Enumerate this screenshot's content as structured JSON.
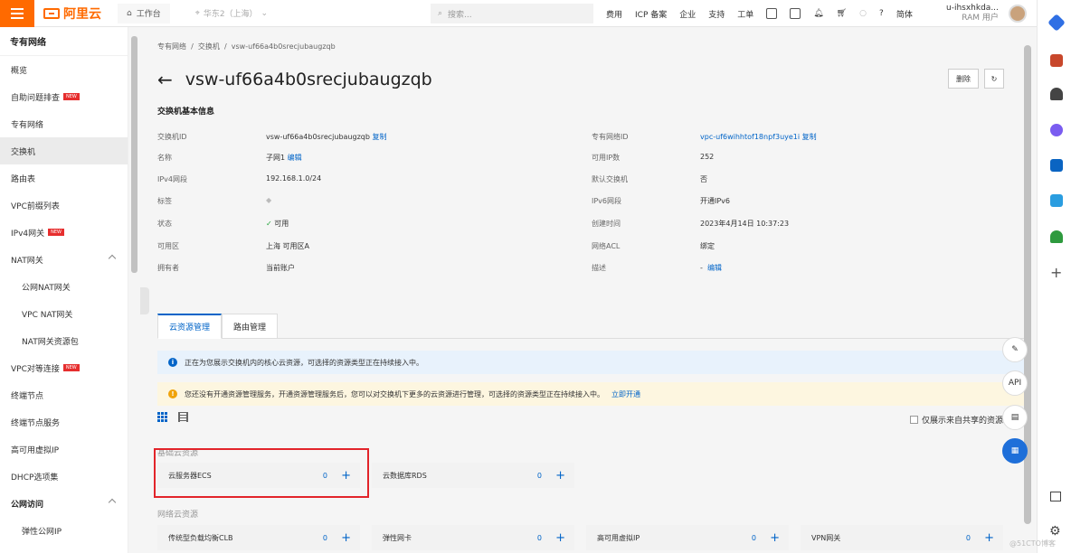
{
  "topbar": {
    "logo_text": "阿里云",
    "workbench": "工作台",
    "region": "华东2（上海）",
    "search_placeholder": "搜索...",
    "nav": [
      "费用",
      "ICP 备案",
      "企业",
      "支持",
      "工单",
      "简体"
    ],
    "username": "u-ihsxhkda...",
    "user_role": "RAM 用户"
  },
  "sidebar": {
    "title": "专有网络",
    "items": [
      {
        "label": "概览"
      },
      {
        "label": "自助问题排查",
        "badge": "NEW"
      },
      {
        "label": "专有网络"
      },
      {
        "label": "交换机",
        "active": true
      },
      {
        "label": "路由表"
      },
      {
        "label": "VPC前缀列表"
      },
      {
        "label": "IPv4网关",
        "badge": "NEW"
      },
      {
        "label": "NAT网关",
        "expanded": true
      },
      {
        "label": "公网NAT网关",
        "sub": true
      },
      {
        "label": "VPC NAT网关",
        "sub": true
      },
      {
        "label": "NAT网关资源包",
        "sub": true
      },
      {
        "label": "VPC对等连接",
        "badge": "NEW"
      },
      {
        "label": "终端节点"
      },
      {
        "label": "终端节点服务"
      },
      {
        "label": "高可用虚拟IP"
      },
      {
        "label": "DHCP选项集"
      },
      {
        "label": "公网访问",
        "group": true,
        "expanded": true
      },
      {
        "label": "弹性公网IP",
        "sub": true
      }
    ]
  },
  "main": {
    "breadcrumb": [
      "专有网络",
      "交换机",
      "vsw-uf66a4b0srecjubaugzqb"
    ],
    "title": "vsw-uf66a4b0srecjubaugzqb",
    "delete_label": "删除",
    "section_title": "交换机基本信息",
    "left_info": [
      {
        "k": "交换机ID",
        "v": "vsw-uf66a4b0srecjubaugzqb",
        "link": "复制"
      },
      {
        "k": "名称",
        "v": "子网1",
        "link": "编辑"
      },
      {
        "k": "IPv4网段",
        "v": "192.168.1.0/24"
      },
      {
        "k": "标签",
        "v": ""
      },
      {
        "k": "状态",
        "v": "可用"
      },
      {
        "k": "可用区",
        "v": "上海 可用区A"
      },
      {
        "k": "拥有者",
        "v": "当前账户"
      }
    ],
    "right_info": [
      {
        "k": "专有网络ID",
        "v": "vpc-uf6wihhtof18npf3uye1i",
        "link": "复制"
      },
      {
        "k": "可用IP数",
        "v": "252"
      },
      {
        "k": "默认交换机",
        "v": "否"
      },
      {
        "k": "IPv6网段",
        "v": "开通IPv6"
      },
      {
        "k": "创建时间",
        "v": "2023年4月14日 10:37:23"
      },
      {
        "k": "网络ACL",
        "v": "绑定"
      },
      {
        "k": "描述",
        "v": "-",
        "link": "编辑"
      }
    ],
    "tabs": [
      "云资源管理",
      "路由管理"
    ],
    "notice_blue": "正在为您展示交换机内的核心云资源，可选择的资源类型正在持续接入中。",
    "notice_yellow": "您还没有开通资源管理服务，开通资源管理服务后，您可以对交换机下更多的云资源进行管理，可选择的资源类型正在持续接入中。",
    "notice_yellow_link": "立即开通",
    "share_checkbox": "仅展示来自共享的资源",
    "group1": "基础云资源",
    "group2": "网络云资源",
    "cards1": [
      {
        "name": "云服务器ECS",
        "count": "0"
      },
      {
        "name": "云数据库RDS",
        "count": "0"
      }
    ],
    "cards2": [
      {
        "name": "传统型负载均衡CLB",
        "count": "0"
      },
      {
        "name": "弹性网卡",
        "count": "0"
      },
      {
        "name": "高可用虚拟IP",
        "count": "0"
      },
      {
        "name": "VPN网关",
        "count": "0"
      }
    ]
  },
  "floating": [
    "API"
  ],
  "watermark": "@51CTO博客"
}
